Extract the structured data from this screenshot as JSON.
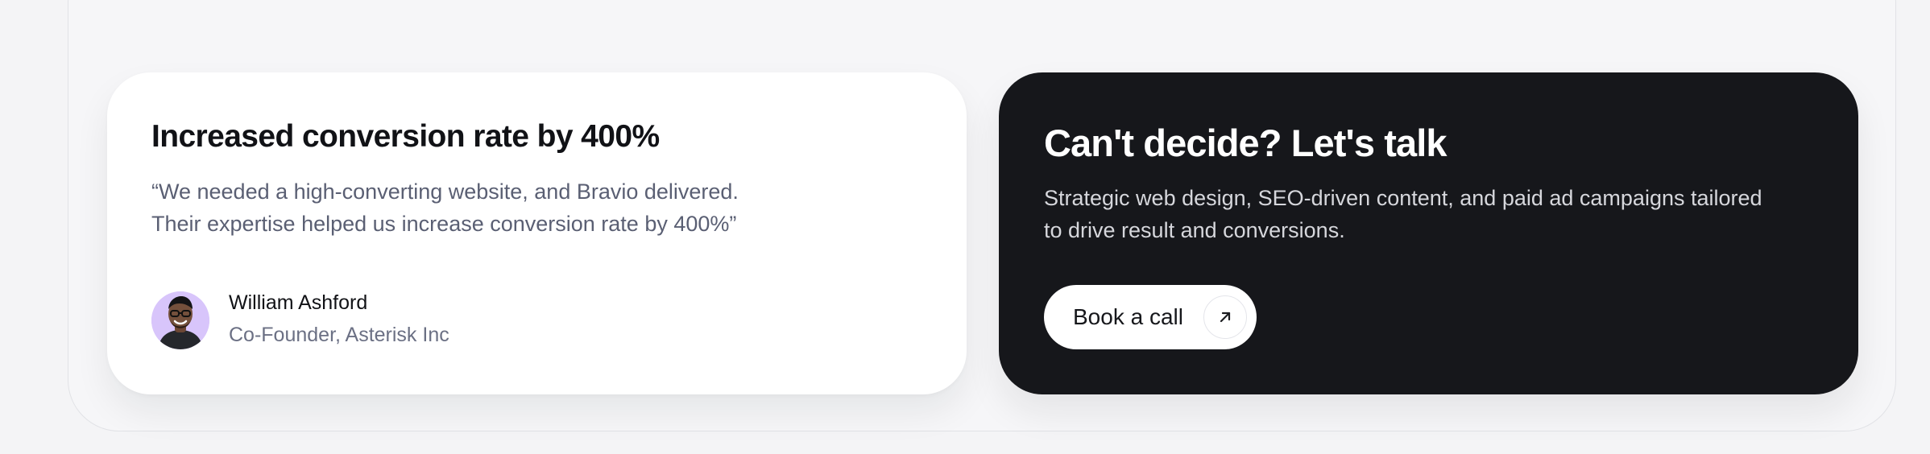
{
  "testimonial": {
    "title": "Increased conversion rate by 400%",
    "quote_lines": [
      "“We needed a high-converting website, and Bravio delivered.",
      "Their expertise helped us increase conversion rate by 400%”"
    ],
    "author": {
      "name": "William Ashford",
      "role": "Co-Founder, Asterisk Inc",
      "avatar_icon": "person-avatar-icon"
    }
  },
  "cta": {
    "title": "Can't decide? Let's talk",
    "description_lines": [
      "Strategic web design, SEO-driven content, and paid ad campaigns tailored",
      "to drive result and conversions."
    ],
    "button_label": "Book a call",
    "button_icon": "arrow-up-right-icon"
  },
  "colors": {
    "page_background": "#f4f4f6",
    "panel_background": "#f6f6f8",
    "testimonial_card": "#ffffff",
    "cta_card": "#16171b",
    "avatar_background": "#d8c5fb",
    "muted_text": "#5a5f73"
  }
}
